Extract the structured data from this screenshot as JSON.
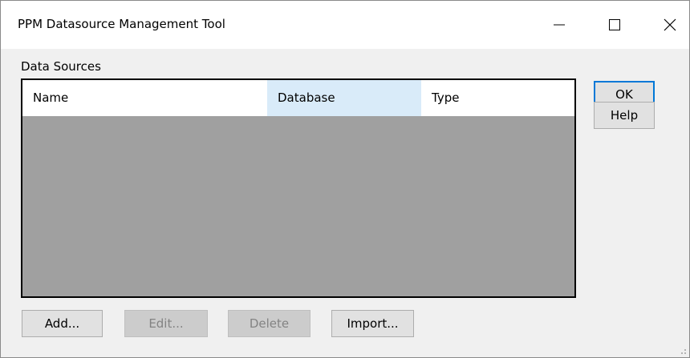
{
  "window": {
    "title": "PPM Datasource Management Tool",
    "controls": {
      "minimize": "—",
      "maximize": "☐",
      "close": "✕"
    }
  },
  "data_sources": {
    "label": "Data Sources",
    "columns": [
      "Name",
      "Database",
      "Type"
    ],
    "rows": []
  },
  "buttons": {
    "ok": "OK",
    "help": "Help",
    "add": "Add...",
    "edit": "Edit...",
    "delete": "Delete",
    "import": "Import..."
  },
  "colors": {
    "accent": "#0078d7",
    "list_empty_background": "#a0a0a0",
    "sorted_column_highlight": "#d9ebf9"
  }
}
